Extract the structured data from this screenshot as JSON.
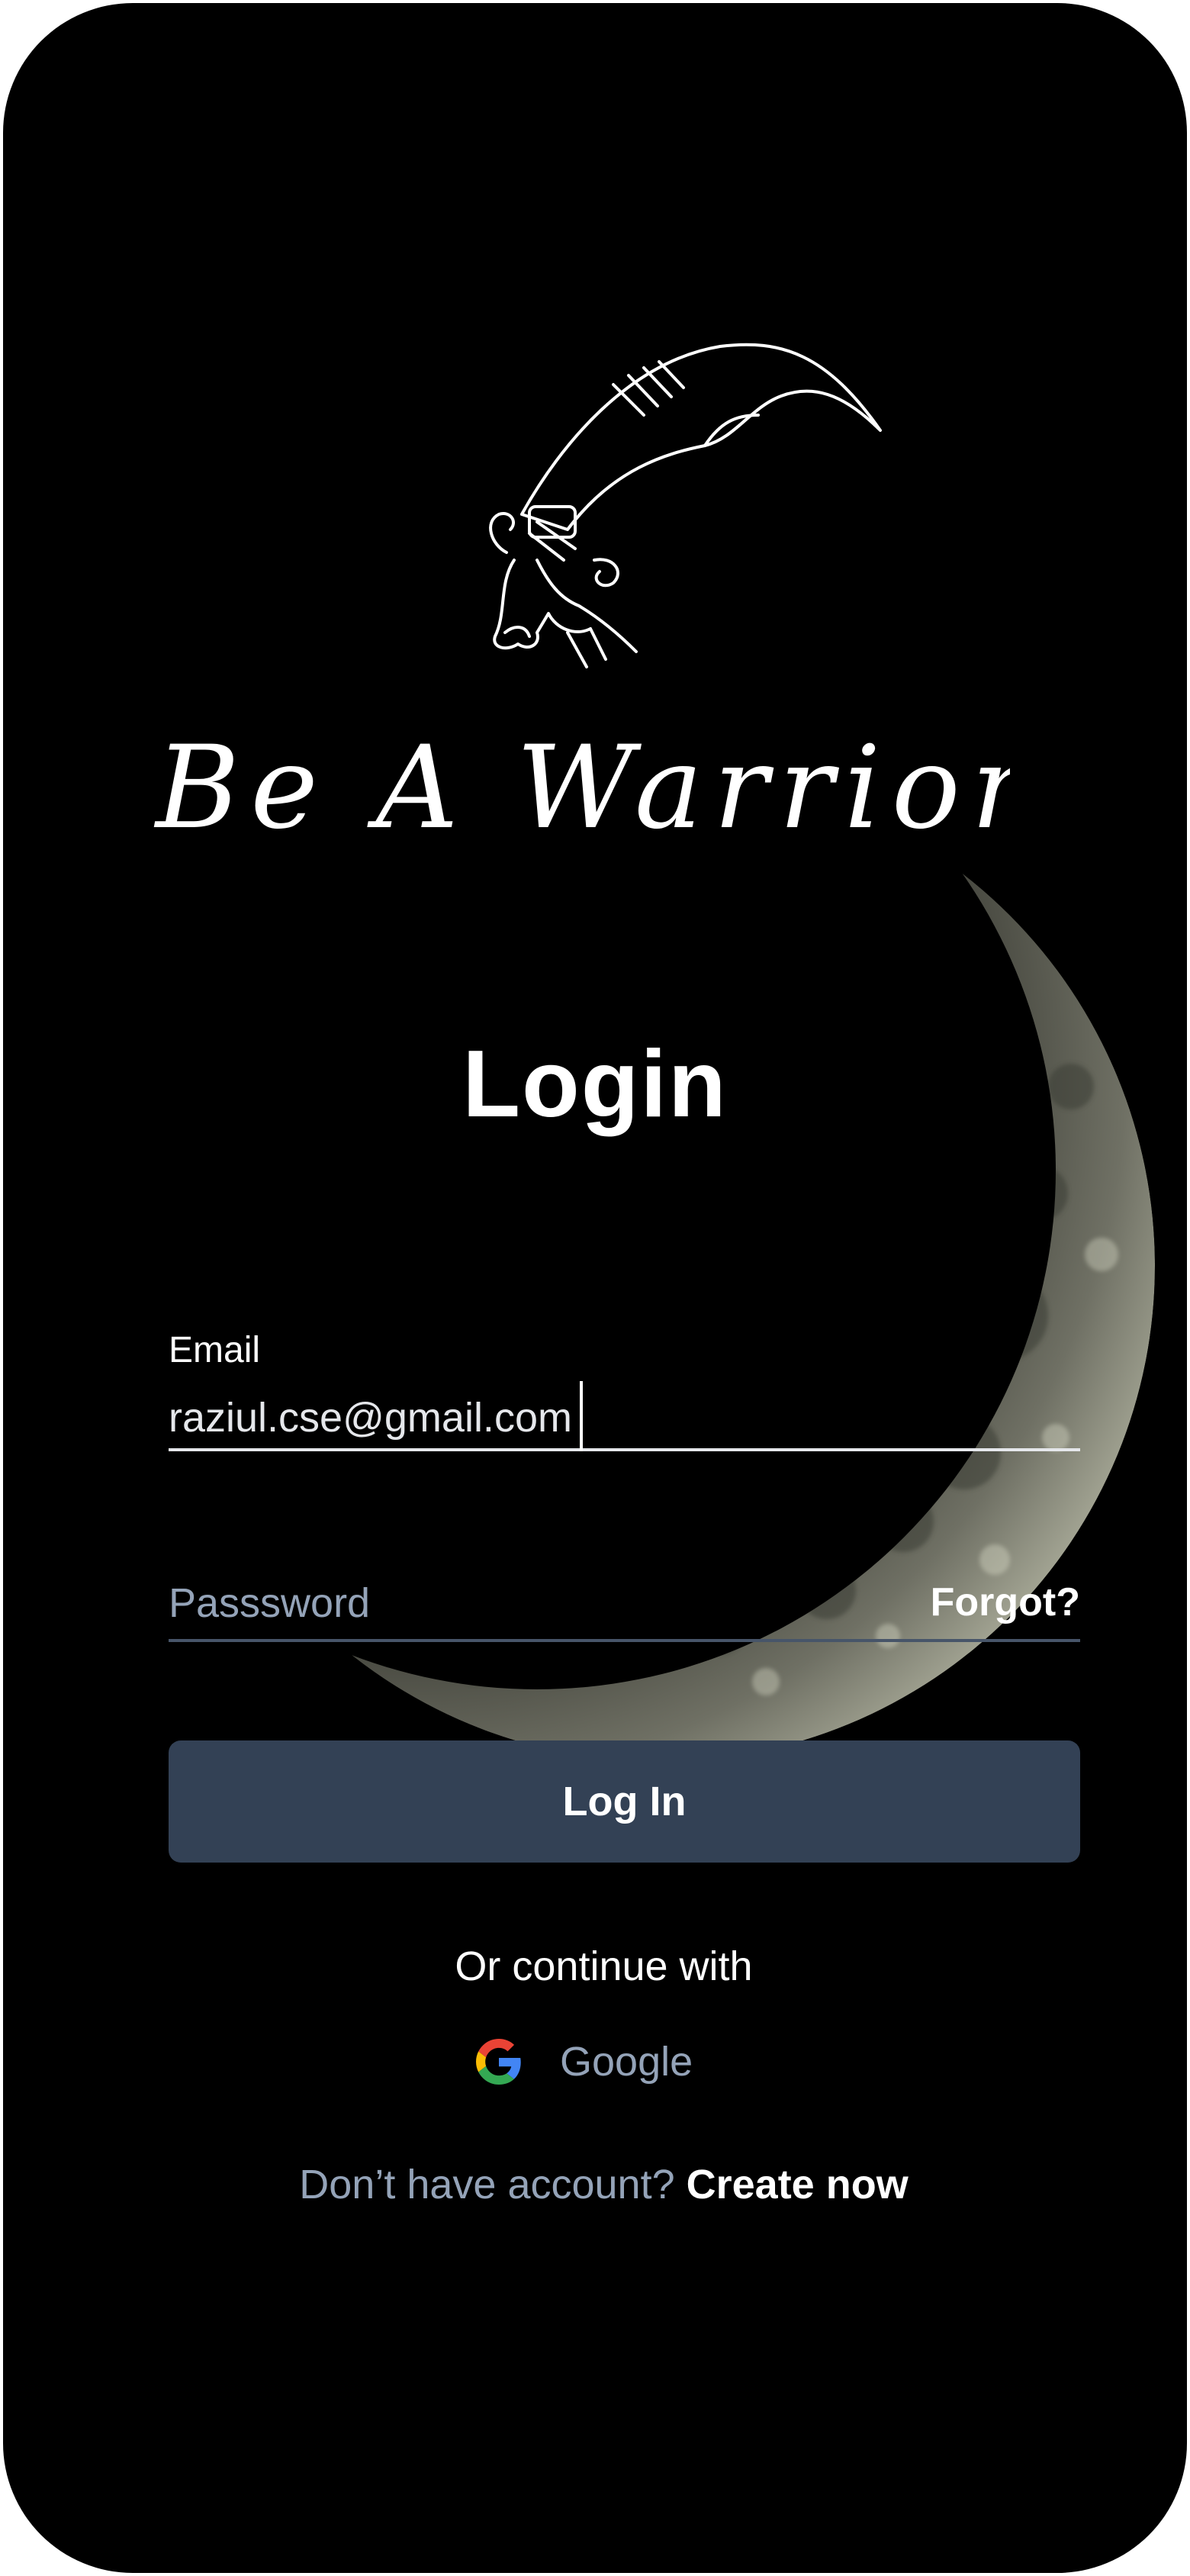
{
  "app": {
    "logo_text": "Be A Warrior"
  },
  "login": {
    "title": "Login",
    "email_label": "Email",
    "email_value": "raziul.cse@gmail.com",
    "password_placeholder": "Passsword",
    "forgot_label": "Forgot?",
    "login_button_label": "Log In",
    "or_continue_label": "Or continue with",
    "google_label": "Google",
    "no_account_prompt": "Don’t have account?",
    "create_link_label": "Create now"
  },
  "icons": {
    "logo": "sword-icon",
    "google": "google-icon"
  },
  "colors": {
    "background": "#000000",
    "button": "#334155",
    "muted_text": "#94a3b8",
    "text": "#ffffff",
    "moon_highlight": "#d9dcc6"
  }
}
